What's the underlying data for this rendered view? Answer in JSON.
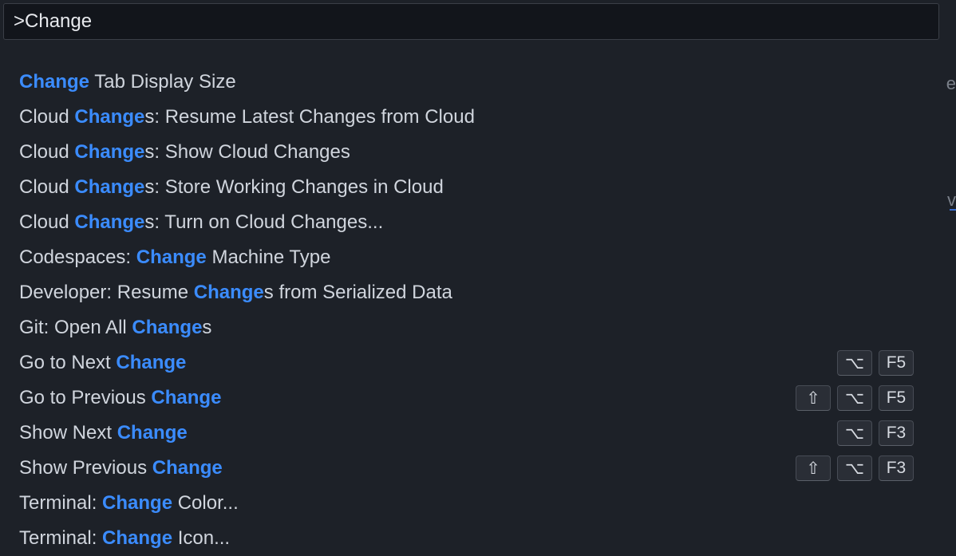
{
  "command_input": {
    "value": ">Change"
  },
  "results": [
    {
      "pre": "",
      "hl": "Change",
      "post": "Tab Display Size",
      "keys": []
    },
    {
      "pre": "Cloud ",
      "hl": "Change",
      "post": "s: Resume Latest Changes from Cloud",
      "keys": []
    },
    {
      "pre": "Cloud ",
      "hl": "Change",
      "post": "s: Show Cloud Changes",
      "keys": []
    },
    {
      "pre": "Cloud ",
      "hl": "Change",
      "post": "s: Store Working Changes in Cloud",
      "keys": []
    },
    {
      "pre": "Cloud ",
      "hl": "Change",
      "post": "s: Turn on Cloud Changes...",
      "keys": []
    },
    {
      "pre": "Codespaces: ",
      "hl": "Change",
      "post": "Machine Type",
      "keys": []
    },
    {
      "pre": "Developer: Resume ",
      "hl": "Change",
      "post": "s from Serialized Data",
      "keys": []
    },
    {
      "pre": "Git: Open All ",
      "hl": "Change",
      "post": "s",
      "keys": []
    },
    {
      "pre": "Go to Next ",
      "hl": "Change",
      "post": "",
      "keys": [
        "⌥",
        "F5"
      ]
    },
    {
      "pre": "Go to Previous ",
      "hl": "Change",
      "post": "",
      "keys": [
        "⇧",
        "⌥",
        "F5"
      ]
    },
    {
      "pre": "Show Next ",
      "hl": "Change",
      "post": "",
      "keys": [
        "⌥",
        "F3"
      ]
    },
    {
      "pre": "Show Previous ",
      "hl": "Change",
      "post": "",
      "keys": [
        "⇧",
        "⌥",
        "F3"
      ]
    },
    {
      "pre": "Terminal: ",
      "hl": "Change",
      "post": "Color...",
      "keys": []
    },
    {
      "pre": "Terminal: ",
      "hl": "Change",
      "post": "Icon...",
      "keys": []
    }
  ],
  "background_editor": {
    "fragment_1": "e",
    "fragment_2": "v"
  }
}
